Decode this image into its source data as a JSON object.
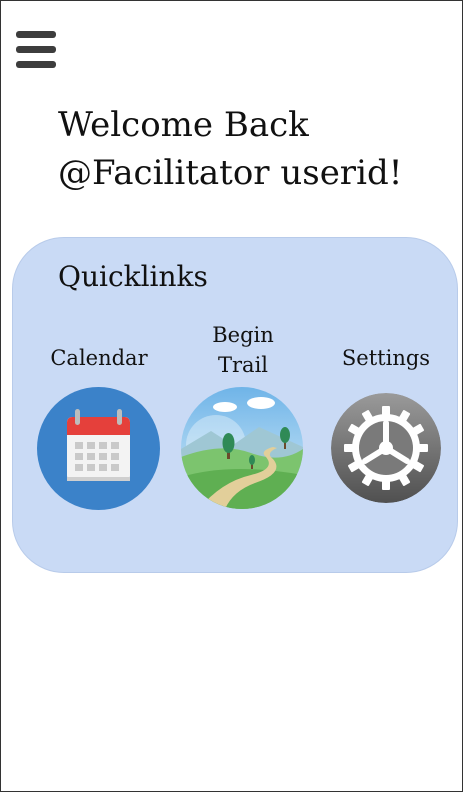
{
  "greeting": {
    "line1": "Welcome Back",
    "line2": "@Facilitator userid!"
  },
  "quicklinks": {
    "title": "Quicklinks",
    "items": [
      {
        "label": "Calendar",
        "icon": "calendar-icon"
      },
      {
        "label_line1": "Begin",
        "label_line2": "Trail",
        "icon": "trail-landscape-icon"
      },
      {
        "label": "Settings",
        "icon": "gear-icon"
      }
    ]
  },
  "colors": {
    "panel_background": "#c9daf5",
    "calendar_circle": "#3b82c9",
    "calendar_header": "#e5403b",
    "settings_circle": "#6b6b6b",
    "menu_icon": "#3d3d3d"
  }
}
